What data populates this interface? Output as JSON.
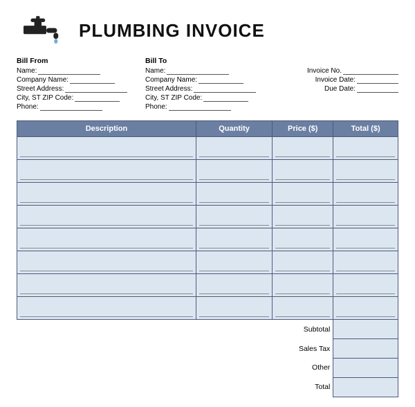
{
  "header": {
    "title": "PLUMBING INVOICE"
  },
  "bill_from": {
    "label": "Bill From",
    "fields": [
      {
        "label": "Name:",
        "line_size": "normal"
      },
      {
        "label": "Company Name:",
        "line_size": "short"
      },
      {
        "label": "Street Address:",
        "line_size": "normal"
      },
      {
        "label": "City, ST ZIP Code:",
        "line_size": "short"
      },
      {
        "label": "Phone:",
        "line_size": "normal"
      }
    ]
  },
  "bill_to": {
    "label": "Bill To",
    "fields": [
      {
        "label": "Name:",
        "line_size": "normal"
      },
      {
        "label": "Company Name:",
        "line_size": "short"
      },
      {
        "label": "Street Address:",
        "line_size": "normal"
      },
      {
        "label": "City, ST ZIP Code:",
        "line_size": "short"
      },
      {
        "label": "Phone:",
        "line_size": "normal"
      }
    ]
  },
  "invoice_info": {
    "fields": [
      {
        "label": "Invoice No.",
        "line_size": "normal"
      },
      {
        "label": "Invoice Date:",
        "line_size": "short"
      },
      {
        "label": "Due Date:",
        "line_size": "short"
      }
    ]
  },
  "table": {
    "headers": [
      "Description",
      "Quantity",
      "Price ($)",
      "Total ($)"
    ],
    "row_count": 8,
    "summary_rows": [
      "Subtotal",
      "Sales Tax",
      "Other",
      "Total"
    ]
  }
}
